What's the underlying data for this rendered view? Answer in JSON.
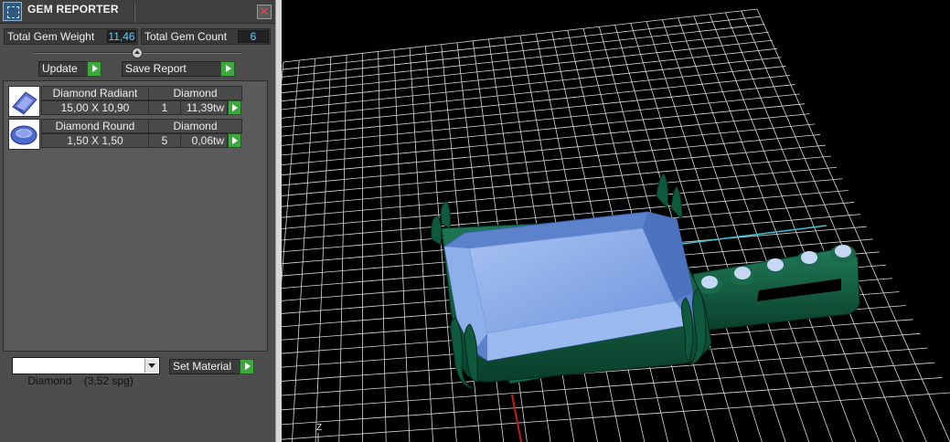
{
  "window": {
    "title": "GEM REPORTER",
    "close_glyph": "✕"
  },
  "stats": {
    "weight_label": "Total Gem Weight",
    "weight_value": "11,46",
    "count_label": "Total Gem Count",
    "count_value": "6"
  },
  "actions": {
    "update_label": "Update",
    "save_report_label": "Save Report"
  },
  "gems": [
    {
      "name": "Diamond Radiant",
      "material": "Diamond",
      "size": "15,00 X 10,90",
      "count": "1",
      "weight": "11,39tw",
      "icon": "radiant-cut-gem-icon"
    },
    {
      "name": "Diamond Round",
      "material": "Diamond",
      "size": "1,50 X 1,50",
      "count": "5",
      "weight": "0,06tw",
      "icon": "round-cut-gem-icon"
    }
  ],
  "material": {
    "selected": "Diamond    (3,52 spg)",
    "set_label": "Set Material"
  },
  "viewport": {
    "axis_label": "Z"
  },
  "colors": {
    "panel": "#4d4d4d",
    "accent_green": "#3ea83e",
    "value_blue": "#66c9ff",
    "gem": "#7fa6e6",
    "metal": "#0f5a3f",
    "grid": "#cfcfcf"
  }
}
